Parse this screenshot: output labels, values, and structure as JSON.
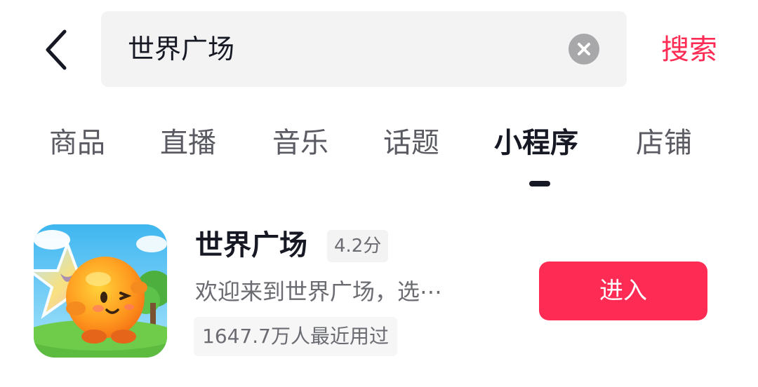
{
  "header": {
    "back_icon": "chevron-left-icon",
    "search": {
      "value": "世界广场",
      "clear_icon": "clear-circle-icon"
    },
    "search_action_label": "搜索"
  },
  "tabs": [
    {
      "label": "商品",
      "active": false
    },
    {
      "label": "直播",
      "active": false
    },
    {
      "label": "音乐",
      "active": false
    },
    {
      "label": "话题",
      "active": false
    },
    {
      "label": "小程序",
      "active": true
    },
    {
      "label": "店铺",
      "active": false
    }
  ],
  "result": {
    "icon": "mini-program-app-icon",
    "name": "世界广场",
    "rating": "4.2分",
    "description": "欢迎来到世界广场，选⋯",
    "users": "1647.7万人最近用过",
    "enter_label": "进入"
  },
  "colors": {
    "accent": "#fe2c55",
    "text_primary": "#161823",
    "text_secondary": "#6b6c72",
    "search_bg": "#f3f3f4"
  }
}
